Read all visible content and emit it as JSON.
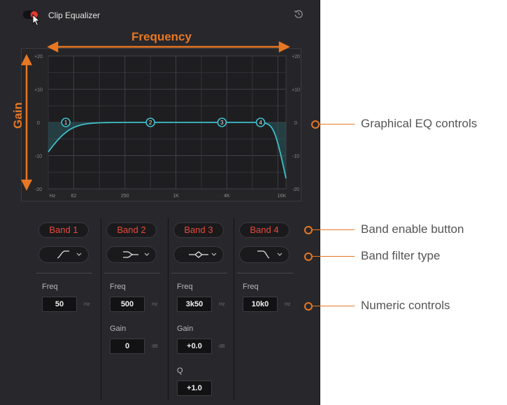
{
  "panel": {
    "title": "Clip Equalizer",
    "toggle_on": true,
    "toggle_color": "#e23b32",
    "reset_icon": "reset-icon"
  },
  "annotations": {
    "frequency": "Frequency",
    "gain": "Gain",
    "graphical_eq": "Graphical EQ controls",
    "band_enable": "Band enable button",
    "filter_type": "Band filter type",
    "numeric": "Numeric controls",
    "accent_color": "#e87722"
  },
  "graph": {
    "y_ticks": [
      "+20",
      "+10",
      "0",
      "-10",
      "-20"
    ],
    "x_ticks": [
      "Hz",
      "62",
      "250",
      "1K",
      "4K",
      "16K"
    ],
    "y_range": [
      -20,
      20
    ],
    "curve_color": "#3fbfc8",
    "handles": [
      {
        "label": "1",
        "freq_hz": 50,
        "gain_db": 0
      },
      {
        "label": "2",
        "freq_hz": 500,
        "gain_db": 0
      },
      {
        "label": "3",
        "freq_hz": 3500,
        "gain_db": 0
      },
      {
        "label": "4",
        "freq_hz": 10000,
        "gain_db": 0
      }
    ]
  },
  "bands": [
    {
      "name": "Band 1",
      "filter_icon": "high-pass-filter-icon",
      "freq_label": "Freq",
      "freq": "50",
      "freq_unit": "Hz"
    },
    {
      "name": "Band 2",
      "filter_icon": "low-shelf-filter-icon",
      "freq_label": "Freq",
      "freq": "500",
      "freq_unit": "Hz",
      "gain_label": "Gain",
      "gain": "0",
      "gain_unit": "dB"
    },
    {
      "name": "Band 3",
      "filter_icon": "bell-filter-icon",
      "freq_label": "Freq",
      "freq": "3k50",
      "freq_unit": "Hz",
      "gain_label": "Gain",
      "gain": "+0.0",
      "gain_unit": "dB",
      "q_label": "Q",
      "q": "+1.0"
    },
    {
      "name": "Band 4",
      "filter_icon": "low-pass-filter-icon",
      "freq_label": "Freq",
      "freq": "10k0",
      "freq_unit": "Hz"
    }
  ]
}
